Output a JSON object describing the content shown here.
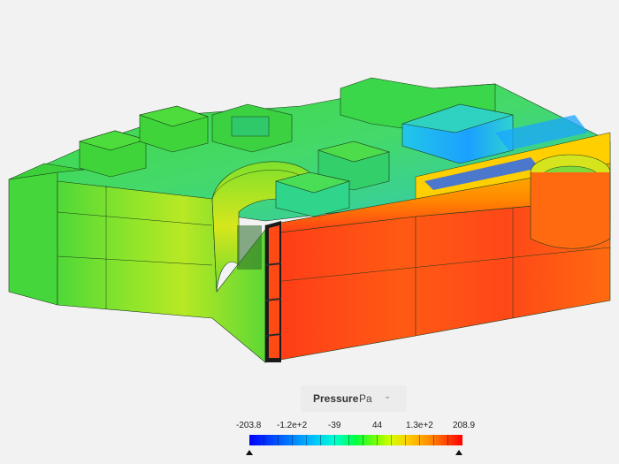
{
  "legend": {
    "field_label": "Pressure",
    "unit": "Pa",
    "unit_chevron_icon": "chevron-down-icon",
    "ticks": [
      "-203.8",
      "-1.2e+2",
      "-39",
      "44",
      "1.3e+2",
      "208.9"
    ],
    "min": -203.8,
    "max": 208.9
  },
  "colors": {
    "background": "#f2f2f2",
    "low": "#0000ff",
    "mid": "#00ff40",
    "high": "#ff0000"
  }
}
